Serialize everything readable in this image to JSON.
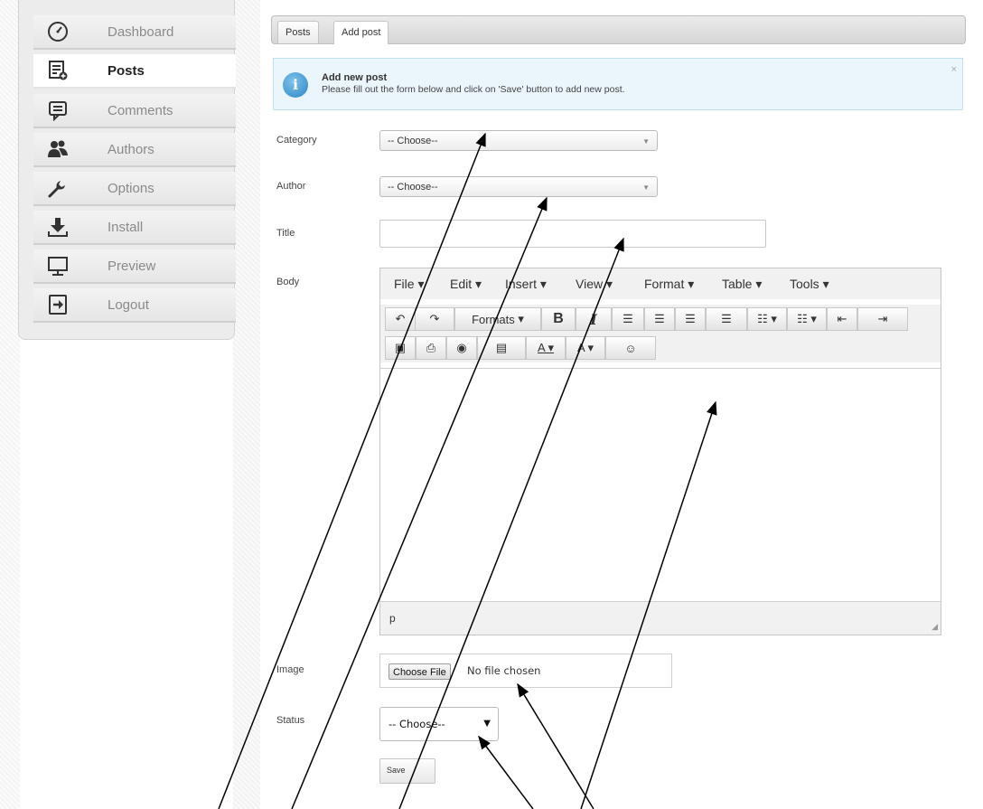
{
  "sidebar": {
    "items": [
      {
        "label": "Dashboard",
        "icon": "dashboard-gauge-icon",
        "active": false
      },
      {
        "label": "Posts",
        "icon": "posts-list-icon",
        "active": true
      },
      {
        "label": "Comments",
        "icon": "comment-icon",
        "active": false
      },
      {
        "label": "Authors",
        "icon": "users-icon",
        "active": false
      },
      {
        "label": "Options",
        "icon": "wrench-icon",
        "active": false
      },
      {
        "label": "Install",
        "icon": "download-icon",
        "active": false
      },
      {
        "label": "Preview",
        "icon": "monitor-icon",
        "active": false
      },
      {
        "label": "Logout",
        "icon": "logout-icon",
        "active": false
      }
    ]
  },
  "tabs": [
    {
      "label": "Posts",
      "active": false
    },
    {
      "label": "Add post",
      "active": true
    }
  ],
  "notice": {
    "title": "Add new post",
    "text": "Please fill out the form below and click on 'Save' button to add new post.",
    "close": "×"
  },
  "form": {
    "category": {
      "label": "Category",
      "value": "-- Choose--"
    },
    "author": {
      "label": "Author",
      "value": "-- Choose--"
    },
    "title": {
      "label": "Title",
      "value": ""
    },
    "body": {
      "label": "Body"
    },
    "image": {
      "label": "Image",
      "button": "Choose File",
      "status": "No file chosen"
    },
    "status": {
      "label": "Status",
      "value": "-- Choose--"
    },
    "save": "Save"
  },
  "editor": {
    "menus": [
      "File",
      "Edit",
      "Insert",
      "View",
      "Format",
      "Table",
      "Tools"
    ],
    "formats_label": "Formats",
    "bold": "B",
    "italic": "I",
    "path": "p"
  },
  "colors": {
    "accent": "#2d86c6",
    "notice_bg": "#eaf5fc"
  }
}
